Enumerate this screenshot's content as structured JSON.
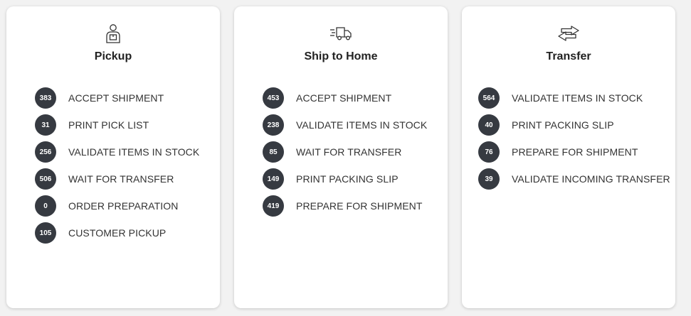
{
  "cards": [
    {
      "title": "Pickup",
      "icon": "person-with-package-icon",
      "steps": [
        {
          "count": "383",
          "label": "ACCEPT SHIPMENT"
        },
        {
          "count": "31",
          "label": "PRINT PICK LIST"
        },
        {
          "count": "256",
          "label": "VALIDATE ITEMS IN STOCK"
        },
        {
          "count": "506",
          "label": "WAIT FOR TRANSFER"
        },
        {
          "count": "0",
          "label": "ORDER PREPARATION"
        },
        {
          "count": "105",
          "label": "CUSTOMER PICKUP"
        }
      ]
    },
    {
      "title": "Ship to Home",
      "icon": "fast-delivery-truck-icon",
      "steps": [
        {
          "count": "453",
          "label": "ACCEPT SHIPMENT"
        },
        {
          "count": "238",
          "label": "VALIDATE ITEMS IN STOCK"
        },
        {
          "count": "85",
          "label": "WAIT FOR TRANSFER"
        },
        {
          "count": "149",
          "label": "PRINT PACKING SLIP"
        },
        {
          "count": "419",
          "label": "PREPARE FOR SHIPMENT"
        }
      ]
    },
    {
      "title": "Transfer",
      "icon": "transfer-arrows-icon",
      "steps": [
        {
          "count": "564",
          "label": "VALIDATE ITEMS IN STOCK"
        },
        {
          "count": "40",
          "label": "PRINT PACKING SLIP"
        },
        {
          "count": "76",
          "label": "PREPARE FOR SHIPMENT"
        },
        {
          "count": "39",
          "label": "VALIDATE INCOMING TRANSFER"
        }
      ]
    }
  ],
  "colors": {
    "badge_background": "#363a41",
    "badge_text": "#ffffff",
    "page_background": "#f2f2f2",
    "card_background": "#ffffff"
  }
}
